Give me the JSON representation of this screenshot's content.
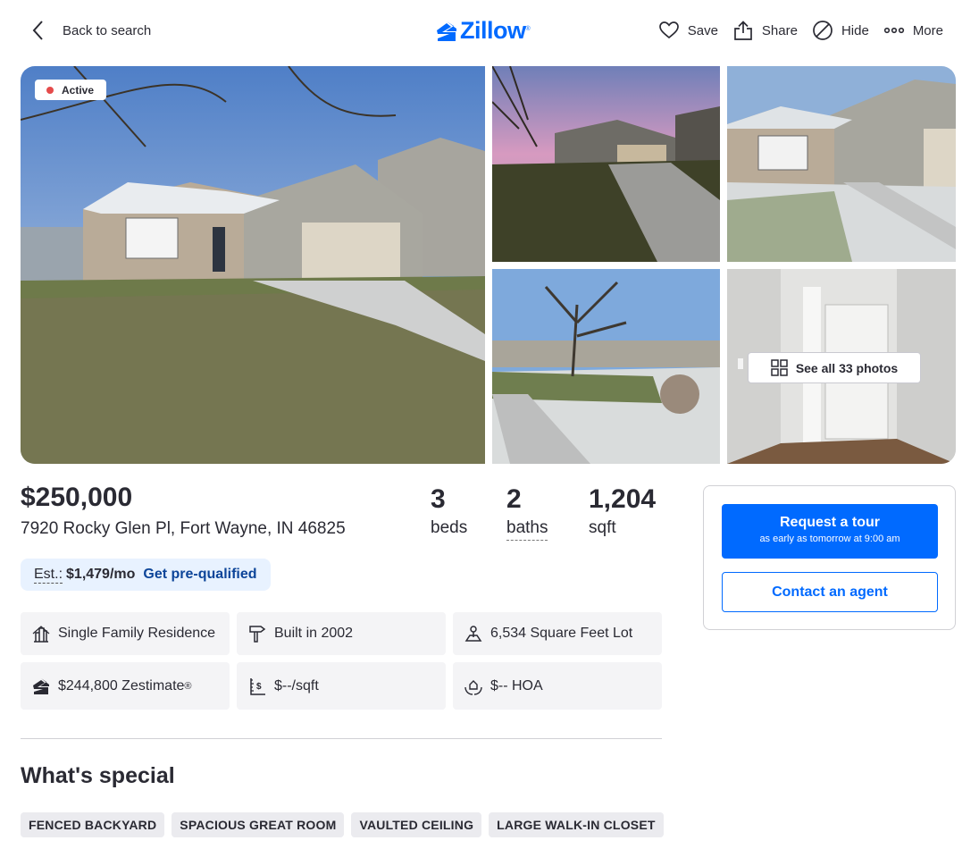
{
  "header": {
    "back_label": "Back to search",
    "logo_text": "Zillow",
    "logo_mark": "®",
    "actions": [
      {
        "label": "Save",
        "icon": "heart-icon"
      },
      {
        "label": "Share",
        "icon": "share-icon"
      },
      {
        "label": "Hide",
        "icon": "hide-icon"
      },
      {
        "label": "More",
        "icon": "more-icon"
      }
    ]
  },
  "gallery": {
    "status_badge": "Active",
    "see_all_label": "See all 33 photos"
  },
  "listing": {
    "price": "$250,000",
    "address": "7920 Rocky Glen Pl, Fort Wayne, IN 46825",
    "beds": {
      "value": "3",
      "label": "beds"
    },
    "baths": {
      "value": "2",
      "label": "baths"
    },
    "sqft": {
      "value": "1,204",
      "label": "sqft"
    },
    "estimate": {
      "label": "Est.:",
      "amount": "$1,479/mo",
      "link": "Get pre-qualified"
    }
  },
  "facts": [
    {
      "text": "Single Family Residence",
      "icon": "building-icon"
    },
    {
      "text": "Built in 2002",
      "icon": "hammer-icon"
    },
    {
      "text": "6,534 Square Feet Lot",
      "icon": "lot-icon"
    },
    {
      "text": "$244,800 Zestimate",
      "sup": "®",
      "icon": "zestimate-icon"
    },
    {
      "text": "$--/sqft",
      "icon": "price-per-sqft-icon"
    },
    {
      "text": "$-- HOA",
      "icon": "hoa-icon"
    }
  ],
  "special": {
    "title": "What's special",
    "tags": [
      "FENCED BACKYARD",
      "SPACIOUS GREAT ROOM",
      "VAULTED CEILING",
      "LARGE WALK-IN CLOSET"
    ]
  },
  "contact": {
    "tour_label": "Request a tour",
    "tour_sub": "as early as tomorrow at 9:00 am",
    "agent_label": "Contact an agent"
  },
  "colors": {
    "brand": "#006aff",
    "link": "#0d4599",
    "active_dot": "#e54b4b",
    "text": "#2a2a33"
  }
}
